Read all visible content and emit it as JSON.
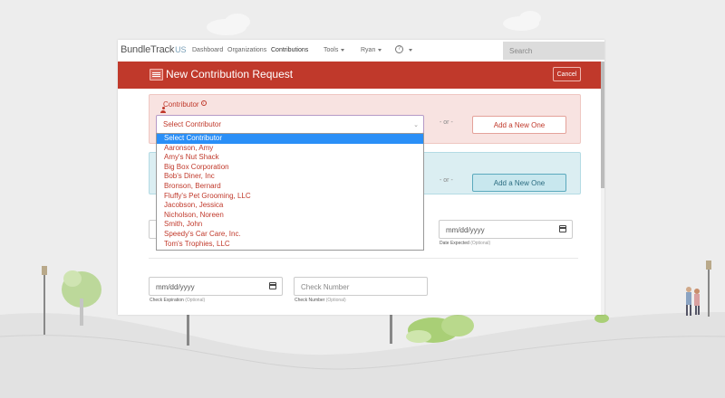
{
  "app": {
    "brand": "BundleTrack",
    "brand_suffix": "US",
    "nav": {
      "dashboard": "Dashboard",
      "organizations": "Organizations",
      "contributions": "Contributions",
      "tools": "Tools",
      "user": "Ryan"
    },
    "search_placeholder": "Search"
  },
  "page": {
    "title": "New Contribution Request",
    "cancel_label": "Cancel"
  },
  "contributor": {
    "label": "Contributor",
    "selected": "Select Contributor",
    "or_label": "- or -",
    "add_label": "Add a New One",
    "options": [
      "Select Contributor",
      "Aaronson, Amy",
      "Amy's Nut Shack",
      "Big Box Corporation",
      "Bob's Diner, Inc",
      "Bronson, Bernard",
      "Fluffy's Pet Grooming, LLC",
      "Jacobson, Jessica",
      "Nicholson, Noreen",
      "Smith, John",
      "Speedy's Car Care, Inc.",
      "Tom's Trophies, LLC"
    ]
  },
  "second_panel": {
    "or_label": "- or -",
    "add_label": "Add a New One"
  },
  "fields": {
    "date_expected": {
      "value": "mm/dd/yyyy",
      "label": "Date Expected",
      "optional": "(Optional)"
    },
    "check_expiration": {
      "value": "mm/dd/yyyy",
      "label": "Check Expiration",
      "optional": "(Optional)"
    },
    "check_number": {
      "placeholder": "Check Number",
      "label": "Check Number",
      "optional": "(Optional)"
    }
  },
  "colors": {
    "brand_red": "#c0392b",
    "selection_blue": "#2a8ff7",
    "panel_red": "#f8e3e1",
    "panel_blue": "#dbeef2"
  }
}
